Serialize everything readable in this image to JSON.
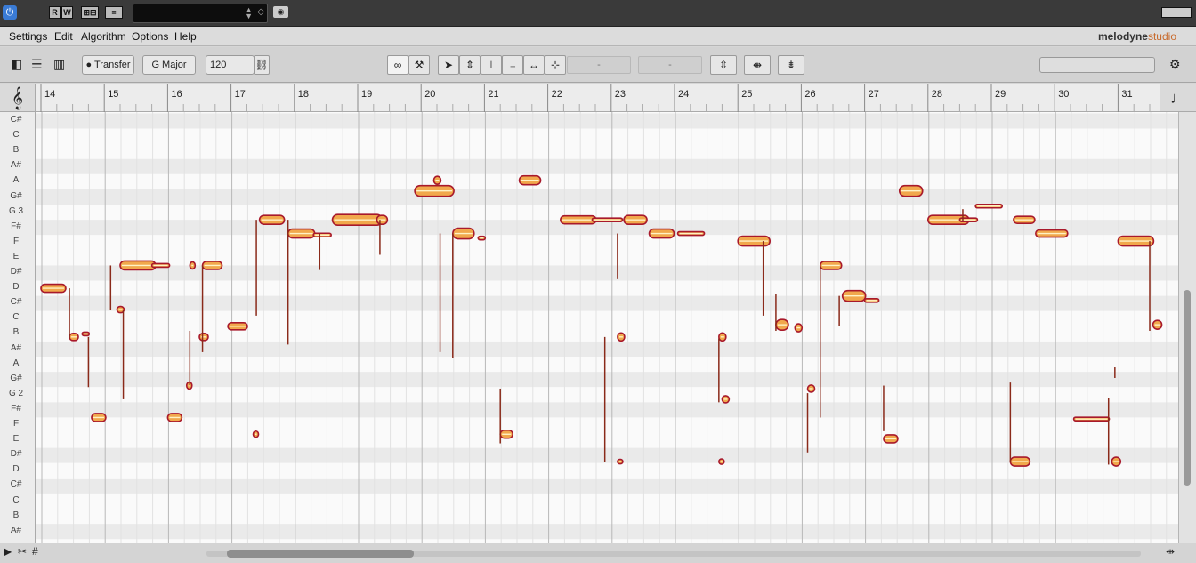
{
  "topbar": {
    "power_icon": "power-icon",
    "buttons": [
      "R",
      "W",
      "⊞⊟",
      "≡"
    ],
    "transport_field": "",
    "camera_icon": "camera-icon"
  },
  "menu": {
    "items": [
      "Settings",
      "Edit",
      "Algorithm",
      "Options",
      "Help"
    ],
    "brand_name": "melodyne",
    "brand_edition": "studio"
  },
  "toolbar": {
    "transfer_label": "Transfer",
    "key_label": "G Major",
    "tempo_value": "120",
    "field_a": "-",
    "field_b": "-"
  },
  "ruler": {
    "bars": [
      "14",
      "15",
      "16",
      "17",
      "18",
      "19",
      "20",
      "21",
      "22",
      "23",
      "24",
      "25",
      "26",
      "27",
      "28",
      "29",
      "30",
      "31"
    ]
  },
  "pitch_ruler": {
    "labels": [
      "C#",
      "C",
      "B",
      "A#",
      "A",
      "G#",
      "G 3",
      "F#",
      "F",
      "E",
      "D#",
      "D",
      "C#",
      "C",
      "B",
      "A#",
      "A",
      "G#",
      "G 2",
      "F#",
      "F",
      "E",
      "D#",
      "D",
      "C#",
      "C",
      "B",
      "A#"
    ]
  },
  "colors": {
    "blob_fill": "#f1a84c",
    "blob_edge": "#a8192b",
    "pitch_line": "#8a2a1a",
    "accent": "#3a7bd5"
  }
}
